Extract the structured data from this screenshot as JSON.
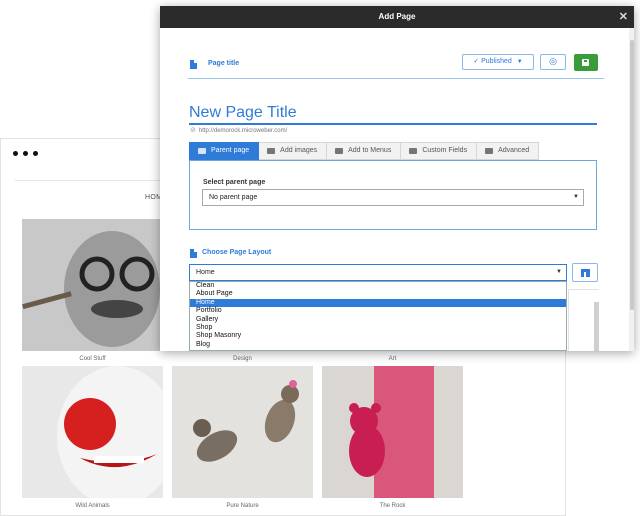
{
  "site": {
    "nav_label": "HOM",
    "tiles": [
      {
        "caption": "Cool Stuff",
        "img": "man-with-glasses-photo"
      },
      {
        "caption": "Design",
        "img": "design-photo"
      },
      {
        "caption": "Art",
        "img": "art-photo"
      },
      {
        "caption": "Wild Animals",
        "img": "clown-photo"
      },
      {
        "caption": "Pure Nature",
        "img": "cats-photo"
      },
      {
        "caption": "The Rock",
        "img": "teddy-bear-photo"
      }
    ]
  },
  "modal": {
    "title": "Add Page",
    "close_icon": "close-icon",
    "toolbar": {
      "label": "Page title",
      "published_label": "Published",
      "published_icon": "check-icon",
      "caret": "caret-down-icon",
      "preview_icon": "eye-icon",
      "save_icon": "floppy-icon"
    },
    "page_title": "New Page Title",
    "url": "http://demorock.microweber.com/",
    "tabs": [
      {
        "label": "Parent page",
        "icon": "folder-icon",
        "active": true
      },
      {
        "label": "Add images",
        "icon": "image-icon",
        "active": false
      },
      {
        "label": "Add to Menus",
        "icon": "menu-icon",
        "active": false
      },
      {
        "label": "Custom Fields",
        "icon": "fields-icon",
        "active": false
      },
      {
        "label": "Advanced",
        "icon": "monitor-icon",
        "active": false
      }
    ],
    "parent_label": "Select parent page",
    "parent_value": "No parent page",
    "layout_label": "Choose Page Layout",
    "layout_value": "Home",
    "layout_options": [
      "Clean",
      "About Page",
      "Home",
      "Portfolio",
      "Gallery",
      "Shop",
      "Shop Masonry",
      "Blog"
    ],
    "layout_selected": "Home"
  },
  "colors": {
    "accent": "#2f7bd8",
    "header": "#2b2b2b",
    "save": "#3a9b3a"
  }
}
